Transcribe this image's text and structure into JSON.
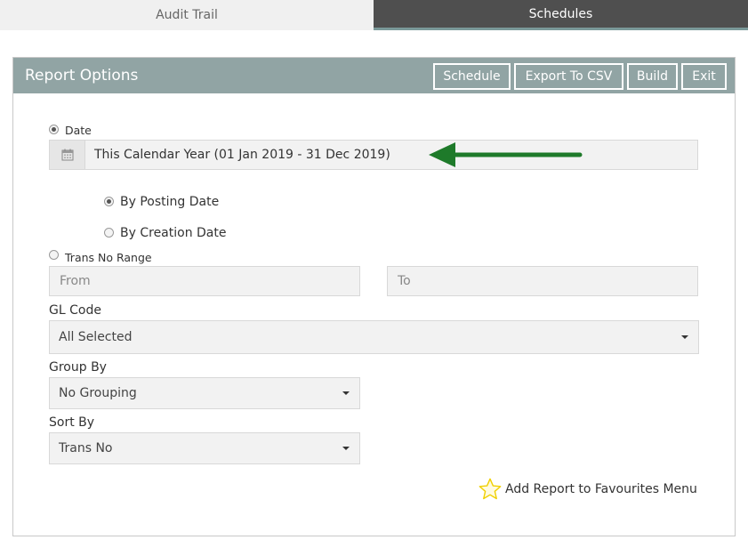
{
  "tabs": [
    {
      "label": "Audit Trail"
    },
    {
      "label": "Schedules"
    }
  ],
  "panel": {
    "title": "Report Options",
    "buttons": {
      "schedule": "Schedule",
      "export_csv": "Export To CSV",
      "build": "Build",
      "exit": "Exit"
    }
  },
  "date": {
    "label": "Date",
    "selected": true,
    "value": "This Calendar Year (01 Jan 2019 - 31 Dec 2019)",
    "icon": "calendar-icon"
  },
  "date_basis": {
    "by_posting": "By Posting Date",
    "by_creation": "By Creation Date",
    "selected": "By Posting Date"
  },
  "trans_no_range": {
    "label": "Trans No Range",
    "selected": false,
    "from_placeholder": "From",
    "to_placeholder": "To"
  },
  "gl_code": {
    "label": "GL Code",
    "value": "All Selected"
  },
  "group_by": {
    "label": "Group By",
    "value": "No Grouping"
  },
  "sort_by": {
    "label": "Sort By",
    "value": "Trans No"
  },
  "favourites": {
    "label": "Add Report to Favourites Menu",
    "icon": "star-icon"
  },
  "colors": {
    "header_bg": "#91a4a4",
    "active_tab_bg": "#4f4f4f",
    "arrow": "#1e7a2a",
    "star": "#f0d000"
  }
}
